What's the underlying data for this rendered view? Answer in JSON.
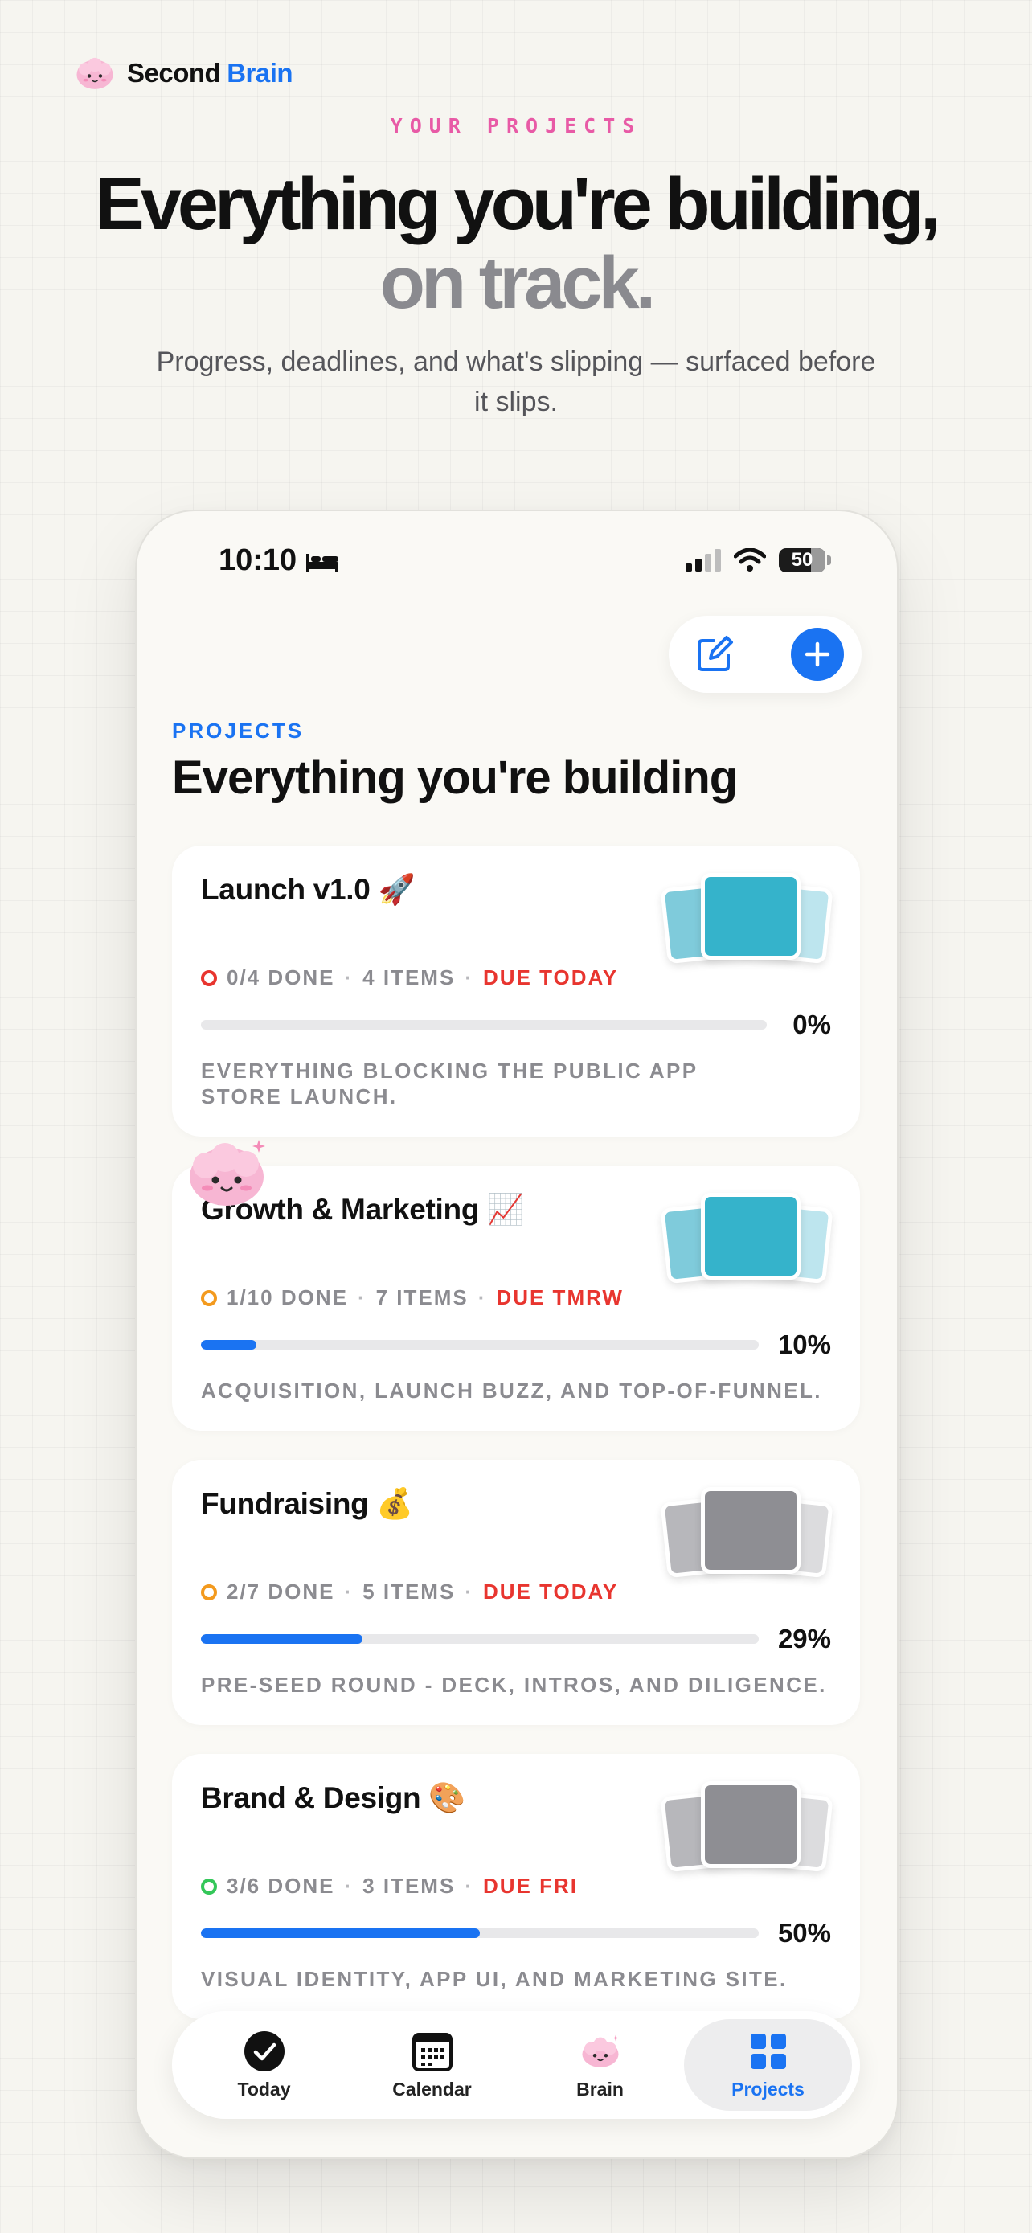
{
  "brand": {
    "name_part1": "Second",
    "name_part2": "Brain"
  },
  "hero": {
    "eyebrow": "YOUR PROJECTS",
    "title_line1": "Everything you're building,",
    "title_line2": "on track.",
    "subtitle": "Progress, deadlines, and what's slipping — surfaced before it slips."
  },
  "status_bar": {
    "time": "10:10",
    "battery": "50"
  },
  "projects_header": {
    "eyebrow": "PROJECTS",
    "title": "Everything you're building"
  },
  "projects": [
    {
      "title": "Launch v1.0 🚀",
      "done": "0/4 DONE",
      "items": "4 ITEMS",
      "due": "DUE TODAY",
      "progress": 0,
      "percent": "0%",
      "description": "EVERYTHING BLOCKING THE PUBLIC APP STORE LAUNCH.",
      "ring_color": "#e8352f",
      "folder_color": "#35b3cb"
    },
    {
      "title": "Growth & Marketing 📈",
      "done": "1/10 DONE",
      "items": "7 ITEMS",
      "due": "DUE TMRW",
      "progress": 0.1,
      "percent": "10%",
      "description": "ACQUISITION, LAUNCH BUZZ, AND TOP-OF-FUNNEL.",
      "ring_color": "#f39a1e",
      "folder_color": "#35b3cb"
    },
    {
      "title": "Fundraising 💰",
      "done": "2/7 DONE",
      "items": "5 ITEMS",
      "due": "DUE TODAY",
      "progress": 0.29,
      "percent": "29%",
      "description": "PRE-SEED ROUND - DECK, INTROS, AND DILIGENCE.",
      "ring_color": "#f39a1e",
      "folder_color": "#8e8e93"
    },
    {
      "title": "Brand & Design 🎨",
      "done": "3/6 DONE",
      "items": "3 ITEMS",
      "due": "DUE FRI",
      "progress": 0.5,
      "percent": "50%",
      "description": "VISUAL IDENTITY, APP UI, AND MARKETING SITE.",
      "ring_color": "#34c759",
      "folder_color": "#8e8e93"
    }
  ],
  "tabs": [
    {
      "label": "Today",
      "icon": "check-circle-icon"
    },
    {
      "label": "Calendar",
      "icon": "calendar-icon"
    },
    {
      "label": "Brain",
      "icon": "brain-mascot-icon"
    },
    {
      "label": "Projects",
      "icon": "grid-icon",
      "active": true
    }
  ],
  "colors": {
    "accent": "#1a73f2",
    "due": "#e8352f",
    "eyebrow_pink": "#e85aa6"
  }
}
